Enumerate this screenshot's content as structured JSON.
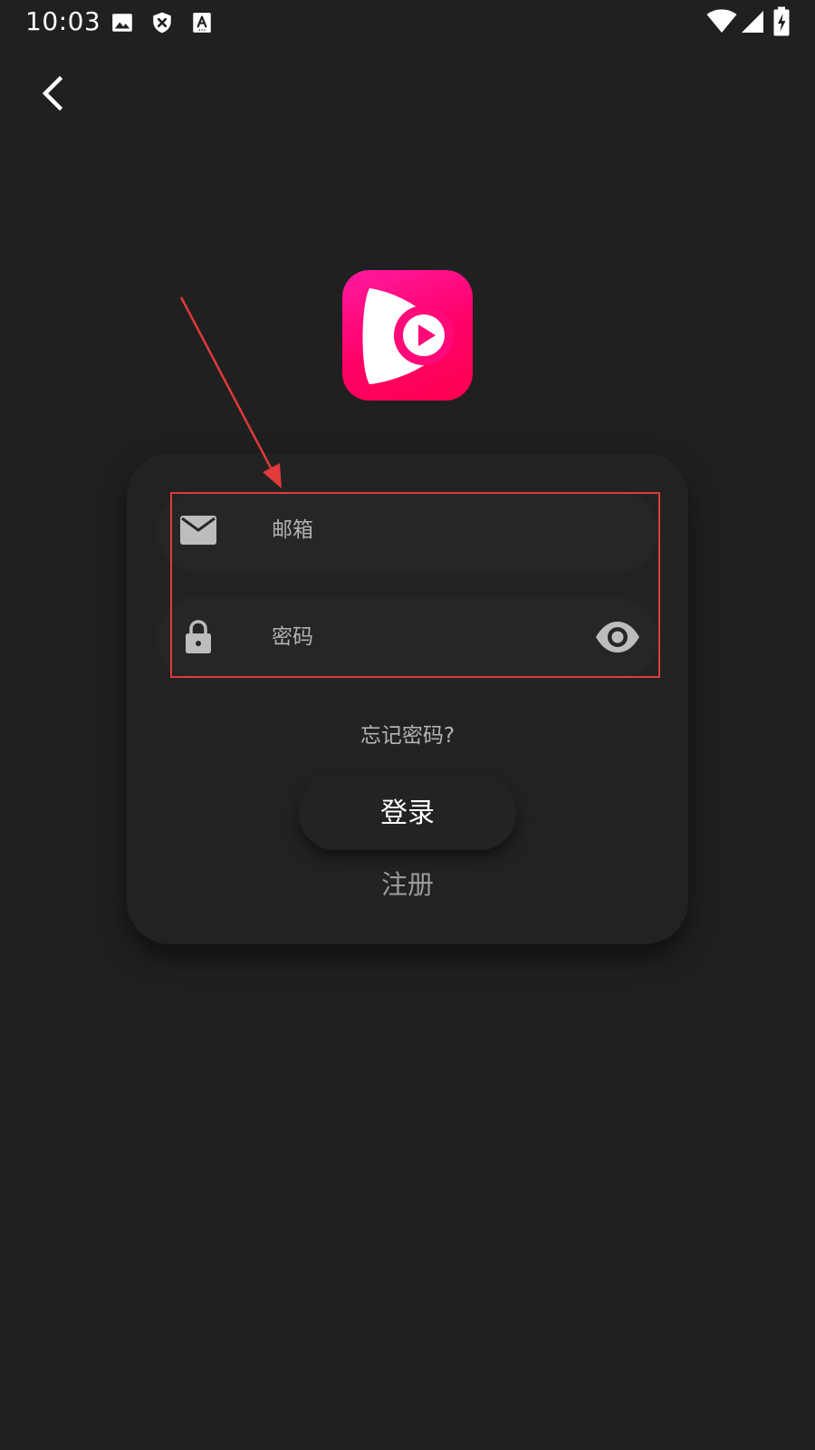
{
  "status_bar": {
    "time": "10:03",
    "left_icons": [
      "image-icon",
      "shield-x-icon",
      "text-a-icon"
    ],
    "right_icons": [
      "wifi-icon",
      "cellular-signal-icon",
      "battery-charging-icon"
    ]
  },
  "nav": {
    "back_icon": "chevron-left-icon"
  },
  "logo": {
    "icon": "video-play-logo",
    "colors": {
      "gradient_start": "#ff1aa0",
      "gradient_end": "#ff0050"
    }
  },
  "login_form": {
    "email": {
      "placeholder": "邮箱",
      "value": "",
      "icon": "mail-icon"
    },
    "password": {
      "placeholder": "密码",
      "value": "",
      "icon": "lock-icon",
      "toggle_icon": "eye-icon"
    },
    "forgot_password": "忘记密码?",
    "login_button": "登录",
    "register_link": "注册"
  },
  "annotation": {
    "color": "#e03a3a",
    "target": "email-and-password-fields"
  },
  "colors": {
    "background": "#202020",
    "card": "#222222",
    "field": "#262626",
    "text_primary": "#ffffff",
    "text_secondary": "#b3b3b3"
  }
}
